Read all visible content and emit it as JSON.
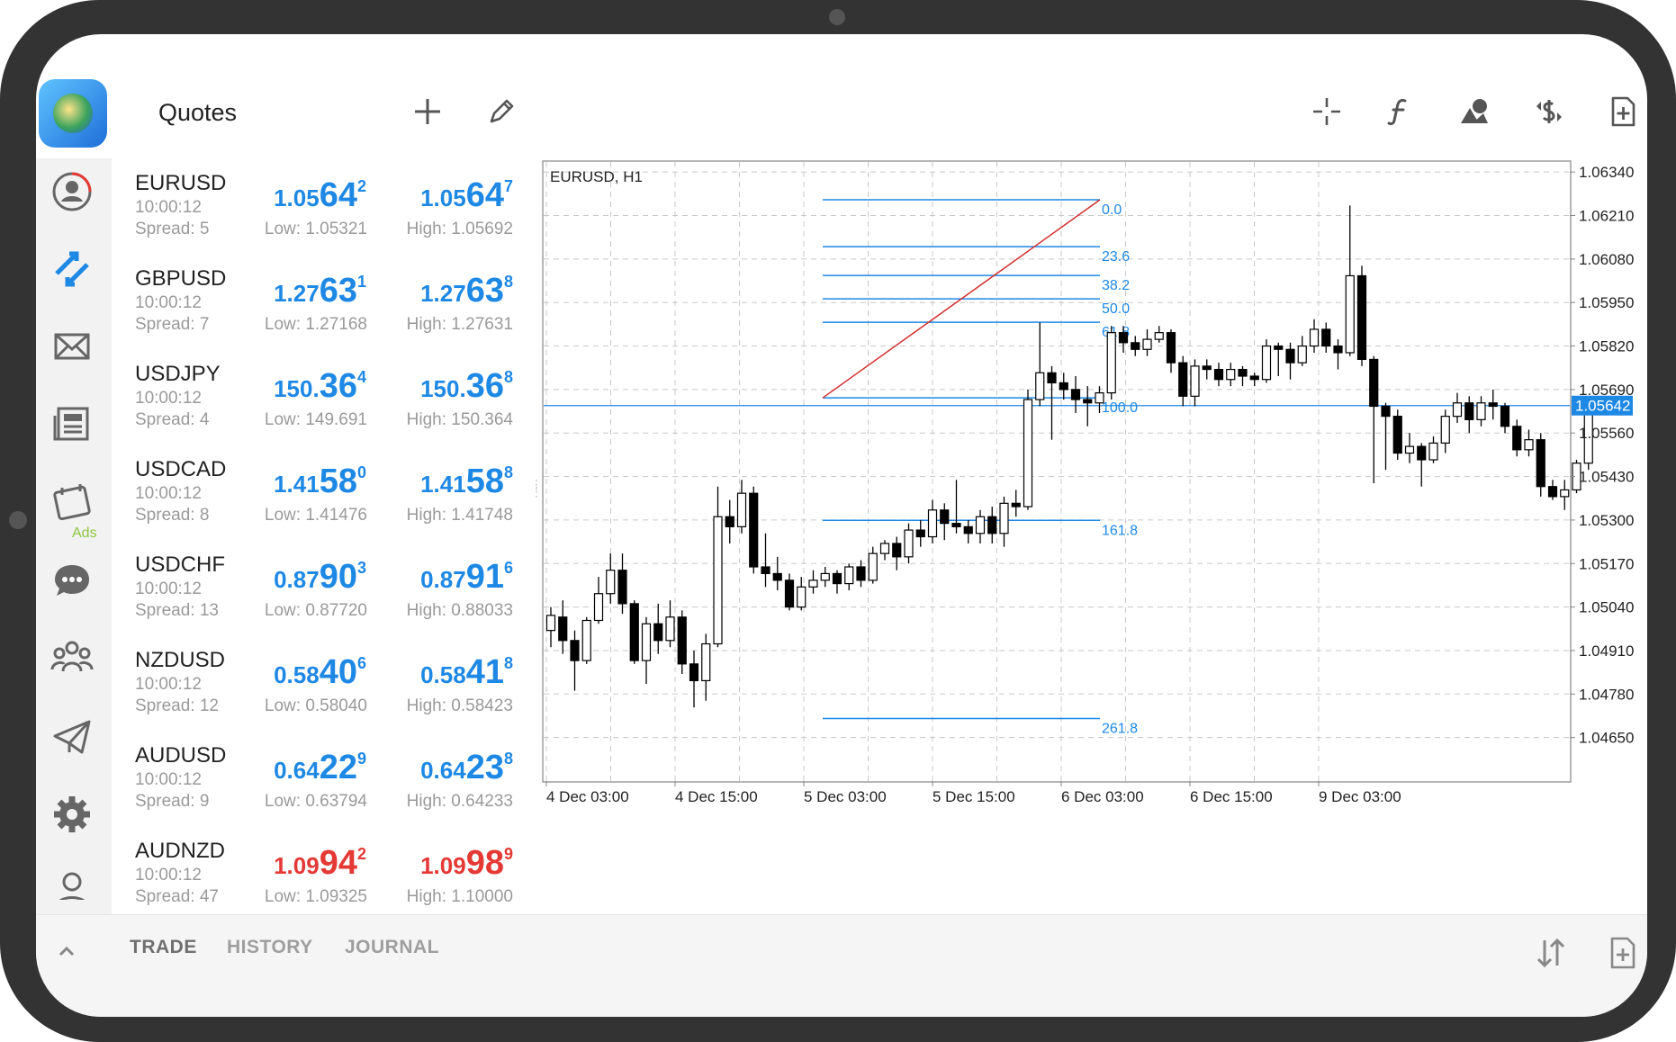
{
  "header": {
    "title": "Quotes"
  },
  "icons": {
    "add": "plus-icon",
    "edit": "pencil-icon",
    "crosshair": "crosshair-icon",
    "indicators": "function-icon",
    "objects": "shapes-icon",
    "trade": "dollar-icon",
    "new_order": "document-plus-icon"
  },
  "quotes": [
    {
      "symbol": "EURUSD",
      "time": "10:00:12",
      "spread": "Spread: 5",
      "bid_small": "1.05",
      "bid_big": "64",
      "bid_sup": "2",
      "ask_small": "1.05",
      "ask_big": "64",
      "ask_sup": "7",
      "low": "Low: 1.05321",
      "high": "High: 1.05692",
      "color": "#1e88e5"
    },
    {
      "symbol": "GBPUSD",
      "time": "10:00:12",
      "spread": "Spread: 7",
      "bid_small": "1.27",
      "bid_big": "63",
      "bid_sup": "1",
      "ask_small": "1.27",
      "ask_big": "63",
      "ask_sup": "8",
      "low": "Low: 1.27168",
      "high": "High: 1.27631",
      "color": "#1e88e5"
    },
    {
      "symbol": "USDJPY",
      "time": "10:00:12",
      "spread": "Spread: 4",
      "bid_small": "150.",
      "bid_big": "36",
      "bid_sup": "4",
      "ask_small": "150.",
      "ask_big": "36",
      "ask_sup": "8",
      "low": "Low: 149.691",
      "high": "High: 150.364",
      "color": "#1e88e5"
    },
    {
      "symbol": "USDCAD",
      "time": "10:00:12",
      "spread": "Spread: 8",
      "bid_small": "1.41",
      "bid_big": "58",
      "bid_sup": "0",
      "ask_small": "1.41",
      "ask_big": "58",
      "ask_sup": "8",
      "low": "Low: 1.41476",
      "high": "High: 1.41748",
      "color": "#1e88e5"
    },
    {
      "symbol": "USDCHF",
      "time": "10:00:12",
      "spread": "Spread: 13",
      "bid_small": "0.87",
      "bid_big": "90",
      "bid_sup": "3",
      "ask_small": "0.87",
      "ask_big": "91",
      "ask_sup": "6",
      "low": "Low: 0.87720",
      "high": "High: 0.88033",
      "color": "#1e88e5"
    },
    {
      "symbol": "NZDUSD",
      "time": "10:00:12",
      "spread": "Spread: 12",
      "bid_small": "0.58",
      "bid_big": "40",
      "bid_sup": "6",
      "ask_small": "0.58",
      "ask_big": "41",
      "ask_sup": "8",
      "low": "Low: 0.58040",
      "high": "High: 0.58423",
      "color": "#1e88e5"
    },
    {
      "symbol": "AUDUSD",
      "time": "10:00:12",
      "spread": "Spread: 9",
      "bid_small": "0.64",
      "bid_big": "22",
      "bid_sup": "9",
      "ask_small": "0.64",
      "ask_big": "23",
      "ask_sup": "8",
      "low": "Low: 0.63794",
      "high": "High: 0.64233",
      "color": "#1e88e5"
    },
    {
      "symbol": "AUDNZD",
      "time": "10:00:12",
      "spread": "Spread: 47",
      "bid_small": "1.09",
      "bid_big": "94",
      "bid_sup": "2",
      "ask_small": "1.09",
      "ask_big": "98",
      "ask_sup": "9",
      "low": "Low: 1.09325",
      "high": "High: 1.10000",
      "color": "#e53935"
    }
  ],
  "nav": {
    "ads_label": "Ads"
  },
  "chart": {
    "symbol_label": "EURUSD, H1",
    "current_price_label": "1.05642",
    "current_price": 1.05642,
    "ylim": [
      1.0452,
      1.0637
    ],
    "y_ticks": [
      "1.06340",
      "1.06210",
      "1.06080",
      "1.05950",
      "1.05820",
      "1.05690",
      "1.05560",
      "1.05430",
      "1.05300",
      "1.05170",
      "1.05040",
      "1.04910",
      "1.04780",
      "1.04650"
    ],
    "x_ticks": [
      "4 Dec 03:00",
      "4 Dec 15:00",
      "5 Dec 03:00",
      "5 Dec 15:00",
      "6 Dec 03:00",
      "6 Dec 15:00",
      "9 Dec 03:00"
    ],
    "fibonacci": {
      "level_0": 1.06257,
      "level_100": 1.05665,
      "levels": [
        {
          "label": "0.0",
          "price": 1.06257
        },
        {
          "label": "23.6",
          "price": 1.06117
        },
        {
          "label": "38.2",
          "price": 1.06031
        },
        {
          "label": "50.0",
          "price": 1.05961
        },
        {
          "label": "61.8",
          "price": 1.05891
        },
        {
          "label": "100.0",
          "price": 1.05665
        },
        {
          "label": "161.8",
          "price": 1.05299
        },
        {
          "label": "261.8",
          "price": 1.04707
        }
      ]
    },
    "colors": {
      "fib": "#1e88e5",
      "trend": "#d32f2f",
      "grid": "#c8c8c8",
      "price_tag": "#1e88e5"
    }
  },
  "chart_data": {
    "type": "candlestick",
    "title": "EURUSD, H1",
    "ylim": [
      1.0452,
      1.0637
    ],
    "candles": [
      [
        1.0497,
        1.05015,
        1.0492,
        1.0504
      ],
      [
        1.0501,
        1.0494,
        1.049,
        1.0506
      ],
      [
        1.0494,
        1.0488,
        1.0479,
        1.0497
      ],
      [
        1.0488,
        1.05,
        1.0487,
        1.0501
      ],
      [
        1.05,
        1.0508,
        1.0499,
        1.0513
      ],
      [
        1.0508,
        1.0515,
        1.0505,
        1.052
      ],
      [
        1.0515,
        1.0505,
        1.0502,
        1.052
      ],
      [
        1.0505,
        1.0488,
        1.0487,
        1.0506
      ],
      [
        1.0488,
        1.0499,
        1.0481,
        1.0501
      ],
      [
        1.0499,
        1.0494,
        1.049,
        1.0505
      ],
      [
        1.0494,
        1.0501,
        1.0492,
        1.0506
      ],
      [
        1.0501,
        1.0487,
        1.0484,
        1.0503
      ],
      [
        1.0487,
        1.0482,
        1.0474,
        1.0491
      ],
      [
        1.0482,
        1.0493,
        1.0476,
        1.0496
      ],
      [
        1.0493,
        1.0531,
        1.0492,
        1.054
      ],
      [
        1.0531,
        1.0528,
        1.0523,
        1.0536
      ],
      [
        1.0528,
        1.0538,
        1.0526,
        1.0542
      ],
      [
        1.0538,
        1.0516,
        1.0514,
        1.054
      ],
      [
        1.0516,
        1.0514,
        1.051,
        1.0526
      ],
      [
        1.0514,
        1.0512,
        1.0509,
        1.0519
      ],
      [
        1.0512,
        1.0504,
        1.0503,
        1.0514
      ],
      [
        1.0504,
        1.051,
        1.0503,
        1.0513
      ],
      [
        1.051,
        1.0512,
        1.0508,
        1.0515
      ],
      [
        1.0512,
        1.0514,
        1.051,
        1.0516
      ],
      [
        1.0514,
        1.0511,
        1.0508,
        1.0515
      ],
      [
        1.0511,
        1.0516,
        1.0509,
        1.0517
      ],
      [
        1.0516,
        1.0512,
        1.051,
        1.0518
      ],
      [
        1.0512,
        1.052,
        1.0511,
        1.0522
      ],
      [
        1.052,
        1.0523,
        1.0518,
        1.0524
      ],
      [
        1.0523,
        1.0519,
        1.0515,
        1.0525
      ],
      [
        1.0519,
        1.0527,
        1.0517,
        1.0529
      ],
      [
        1.0527,
        1.0525,
        1.0522,
        1.053
      ],
      [
        1.0525,
        1.0533,
        1.0523,
        1.0536
      ],
      [
        1.0533,
        1.0529,
        1.0524,
        1.0535
      ],
      [
        1.0529,
        1.0528,
        1.0526,
        1.0542
      ],
      [
        1.0528,
        1.0526,
        1.0523,
        1.053
      ],
      [
        1.0526,
        1.0531,
        1.0523,
        1.0533
      ],
      [
        1.0531,
        1.0526,
        1.0523,
        1.0534
      ],
      [
        1.0526,
        1.0535,
        1.0522,
        1.0537
      ],
      [
        1.0535,
        1.0534,
        1.0531,
        1.0539
      ],
      [
        1.0534,
        1.0566,
        1.0533,
        1.0569
      ],
      [
        1.0566,
        1.0574,
        1.0564,
        1.0589
      ],
      [
        1.0574,
        1.0571,
        1.0554,
        1.0576
      ],
      [
        1.0571,
        1.0569,
        1.0566,
        1.0574
      ],
      [
        1.0569,
        1.0566,
        1.0562,
        1.0573
      ],
      [
        1.0566,
        1.0565,
        1.0558,
        1.057
      ],
      [
        1.0565,
        1.0568,
        1.0562,
        1.057
      ],
      [
        1.0568,
        1.0586,
        1.0566,
        1.0588
      ],
      [
        1.0586,
        1.0583,
        1.058,
        1.0588
      ],
      [
        1.0583,
        1.0581,
        1.0579,
        1.0585
      ],
      [
        1.0581,
        1.0584,
        1.0579,
        1.0587
      ],
      [
        1.0584,
        1.0586,
        1.0583,
        1.0588
      ],
      [
        1.0586,
        1.0577,
        1.0574,
        1.0587
      ],
      [
        1.0577,
        1.0567,
        1.0564,
        1.0579
      ],
      [
        1.0567,
        1.0576,
        1.0564,
        1.0578
      ],
      [
        1.0576,
        1.0575,
        1.0572,
        1.0578
      ],
      [
        1.0575,
        1.0572,
        1.057,
        1.0577
      ],
      [
        1.0572,
        1.0575,
        1.057,
        1.0577
      ],
      [
        1.0575,
        1.0573,
        1.057,
        1.0576
      ],
      [
        1.0573,
        1.0572,
        1.057,
        1.0574
      ],
      [
        1.0572,
        1.0582,
        1.0571,
        1.0584
      ],
      [
        1.0582,
        1.0581,
        1.0573,
        1.0583
      ],
      [
        1.0581,
        1.0577,
        1.0572,
        1.0583
      ],
      [
        1.0577,
        1.0582,
        1.0576,
        1.0585
      ],
      [
        1.0582,
        1.0587,
        1.058,
        1.059
      ],
      [
        1.0587,
        1.0582,
        1.058,
        1.0589
      ],
      [
        1.0582,
        1.058,
        1.0575,
        1.0584
      ],
      [
        1.058,
        1.0603,
        1.0579,
        1.0624
      ],
      [
        1.0603,
        1.0578,
        1.0576,
        1.0606
      ],
      [
        1.0578,
        1.0564,
        1.0541,
        1.0579
      ],
      [
        1.0564,
        1.0561,
        1.0545,
        1.0565
      ],
      [
        1.0561,
        1.055,
        1.0548,
        1.0563
      ],
      [
        1.055,
        1.0552,
        1.0547,
        1.0556
      ],
      [
        1.0552,
        1.0548,
        1.054,
        1.0553
      ],
      [
        1.0548,
        1.0553,
        1.0547,
        1.0555
      ],
      [
        1.0553,
        1.0561,
        1.055,
        1.0563
      ],
      [
        1.0561,
        1.0565,
        1.0559,
        1.0568
      ],
      [
        1.0565,
        1.056,
        1.0556,
        1.0567
      ],
      [
        1.056,
        1.0565,
        1.0558,
        1.0567
      ],
      [
        1.0565,
        1.0564,
        1.056,
        1.0569
      ],
      [
        1.0564,
        1.0558,
        1.0556,
        1.0565
      ],
      [
        1.0558,
        1.0551,
        1.0549,
        1.056
      ],
      [
        1.0551,
        1.0554,
        1.0549,
        1.0557
      ],
      [
        1.0554,
        1.054,
        1.0537,
        1.0556
      ],
      [
        1.054,
        1.0537,
        1.0536,
        1.0542
      ],
      [
        1.0537,
        1.0539,
        1.0533,
        1.0542
      ],
      [
        1.0539,
        1.0547,
        1.0538,
        1.0548
      ],
      [
        1.0547,
        1.0564,
        1.0545,
        1.0567
      ],
      [
        1.0564,
        1.0565,
        1.0562,
        1.0566
      ]
    ]
  },
  "bottom": {
    "tabs": [
      {
        "label": "TRADE",
        "active": true
      },
      {
        "label": "HISTORY",
        "active": false
      },
      {
        "label": "JOURNAL",
        "active": false
      }
    ]
  }
}
